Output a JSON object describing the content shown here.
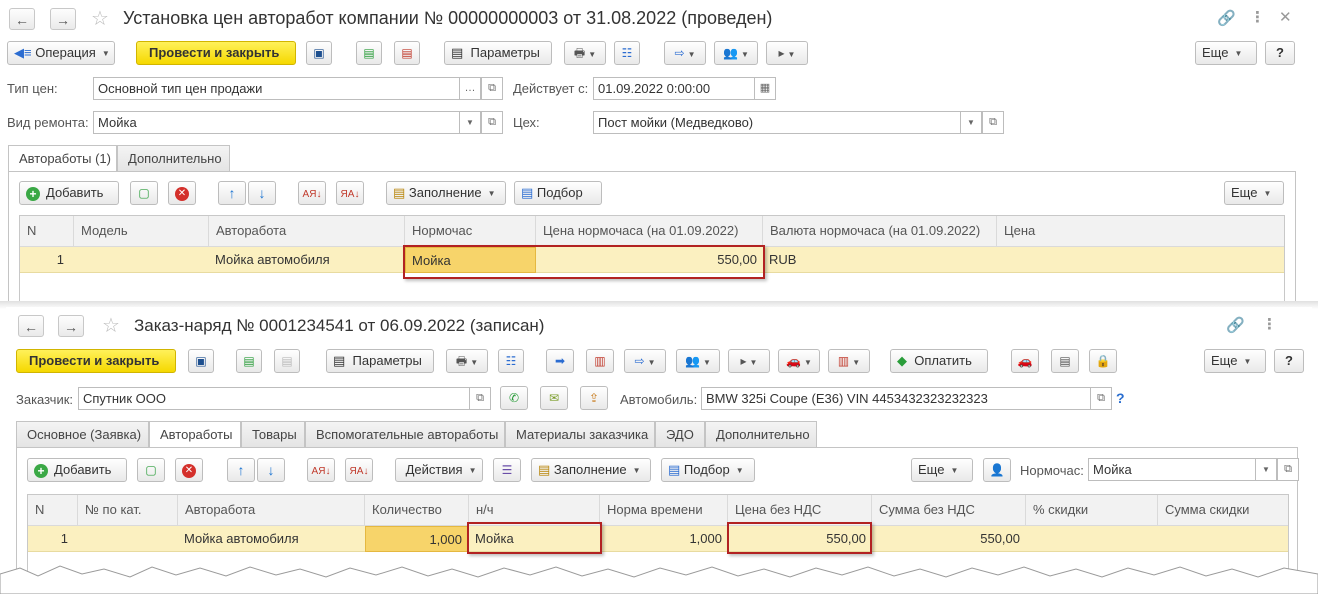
{
  "doc1": {
    "title": "Установка цен авторабот компании № 00000000003 от 31.08.2022 (проведен)",
    "toolbar": {
      "operation": "Операция",
      "post_close": "Провести и закрыть",
      "params": "Параметры",
      "more": "Еще",
      "help": "?"
    },
    "fields": {
      "price_type_label": "Тип цен:",
      "price_type_value": "Основной тип цен продажи",
      "valid_from_label": "Действует с:",
      "valid_from_value": "01.09.2022  0:00:00",
      "repair_type_label": "Вид ремонта:",
      "repair_type_value": "Мойка",
      "workshop_label": "Цех:",
      "workshop_value": "Пост мойки (Медведково)"
    },
    "tabs": [
      "Автоработы (1)",
      "Дополнительно"
    ],
    "tab_toolbar": {
      "add": "Добавить",
      "fill": "Заполнение",
      "pick": "Подбор",
      "more": "Еще"
    },
    "table": {
      "columns": [
        "N",
        "Модель",
        "Авторабота",
        "Нормочас",
        "Цена нормочаса (на 01.09.2022)",
        "Валюта нормочаса (на 01.09.2022)",
        "Цена"
      ],
      "rows": [
        [
          "1",
          "",
          "Мойка автомобиля",
          "Мойка",
          "550,00",
          "RUB",
          ""
        ]
      ]
    }
  },
  "doc2": {
    "title": "Заказ-наряд № 0001234541  от 06.09.2022 (записан)",
    "toolbar": {
      "post_close": "Провести и закрыть",
      "params": "Параметры",
      "pay": "Оплатить",
      "more": "Еще",
      "help": "?"
    },
    "fields": {
      "customer_label": "Заказчик:",
      "customer_value": "Спутник ООО",
      "car_label": "Автомобиль:",
      "car_value": "BMW 325i Coupe (E36) VIN 4453432323232323",
      "car_help": "?"
    },
    "tabs": [
      "Основное (Заявка)",
      "Автоработы",
      "Товары",
      "Вспомогательные автоработы",
      "Материалы заказчика",
      "ЭДО",
      "Дополнительно"
    ],
    "tab_toolbar": {
      "add": "Добавить",
      "actions": "Действия",
      "fill": "Заполнение",
      "pick": "Подбор",
      "more": "Еще",
      "norm_label": "Нормочас:",
      "norm_value": "Мойка"
    },
    "table": {
      "columns": [
        "N",
        "№ по кат.",
        "Авторабота",
        "Количество",
        "н/ч",
        "Норма времени",
        "Цена без НДС",
        "Сумма без НДС",
        "% скидки",
        "Сумма скидки"
      ],
      "rows": [
        [
          "1",
          "",
          "Мойка автомобиля",
          "1,000",
          "Мойка",
          "1,000",
          "550,00",
          "550,00",
          "",
          ""
        ]
      ]
    }
  }
}
